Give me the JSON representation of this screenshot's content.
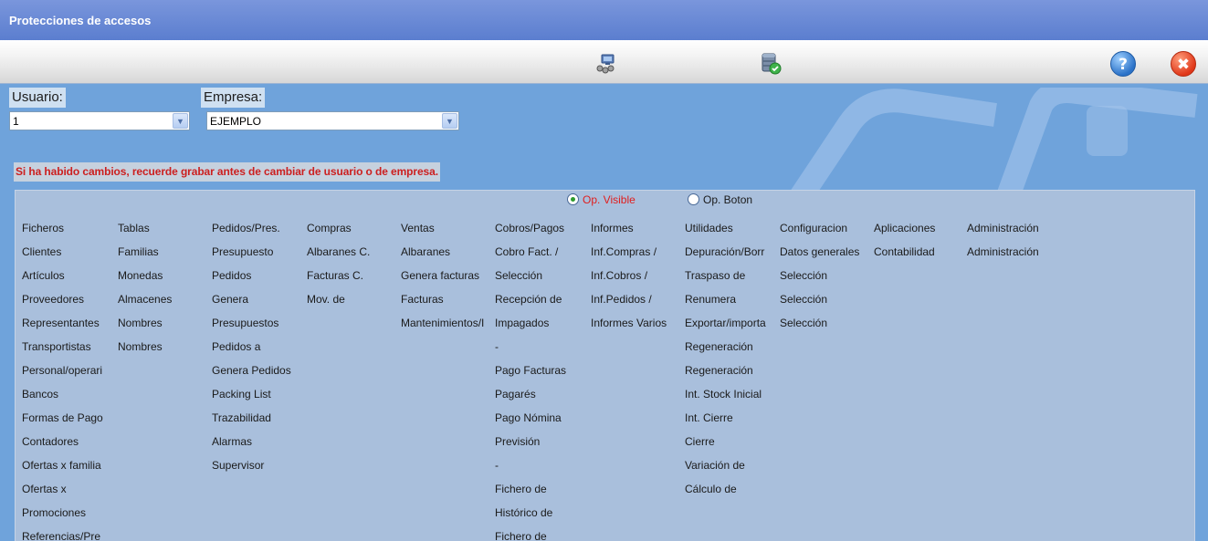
{
  "window": {
    "title": "Protecciones de accesos"
  },
  "toolbar": {
    "icons": [
      "users-network-icon",
      "database-check-icon"
    ],
    "help_glyph": "?",
    "close_glyph": "✖"
  },
  "usuario": {
    "label": "Usuario:",
    "value": "1"
  },
  "empresa": {
    "label": "Empresa:",
    "value": "EJEMPLO"
  },
  "warning": "Si ha habido cambios, recuerde grabar antes de cambiar de usuario o de empresa.",
  "options": {
    "visible": {
      "label": "Op. Visible",
      "selected": true
    },
    "boton": {
      "label": "Op. Boton",
      "selected": false
    }
  },
  "colors": {
    "warning": "#cc1f1f",
    "selected_option": "#e01e1e",
    "panel": "#a9bfdc"
  },
  "menu_columns": [
    {
      "items": [
        "Ficheros",
        "Clientes",
        "Artículos",
        "Proveedores",
        "Representantes",
        "Transportistas",
        "Personal/operari",
        "Bancos",
        "Formas de Pago",
        "Contadores",
        "Ofertas x familia",
        "Ofertas x",
        "Promociones",
        "Referencias/Pre"
      ]
    },
    {
      "items": [
        "Tablas",
        "Familias",
        "Monedas",
        "Almacenes",
        "Nombres",
        "Nombres"
      ]
    },
    {
      "items": [
        "Pedidos/Pres.",
        "Presupuesto",
        "Pedidos",
        "Genera",
        "Presupuestos",
        "Pedidos a",
        "Genera Pedidos",
        "Packing List",
        "Trazabilidad",
        "Alarmas",
        "Supervisor"
      ]
    },
    {
      "items": [
        "Compras",
        "Albaranes C.",
        "Facturas C.",
        "Mov. de"
      ]
    },
    {
      "items": [
        "Ventas",
        "Albaranes",
        "Genera facturas",
        "Facturas",
        "Mantenimientos/I"
      ]
    },
    {
      "items": [
        "Cobros/Pagos",
        "Cobro Fact. /",
        "Selección",
        "Recepción de",
        "Impagados",
        "-",
        "Pago Facturas",
        "Pagarés",
        "Pago Nómina",
        "Previsión",
        "-",
        "Fichero de",
        "Histórico de",
        "Fichero de"
      ]
    },
    {
      "items": [
        "Informes",
        "Inf.Compras /",
        "Inf.Cobros /",
        "Inf.Pedidos /",
        "Informes Varios"
      ]
    },
    {
      "items": [
        "Utilidades",
        "Depuración/Borr",
        "Traspaso de",
        "Renumera",
        "Exportar/importa",
        "Regeneración",
        "Regeneración",
        "Int. Stock Inicial",
        "Int. Cierre",
        "Cierre",
        "Variación de",
        "Cálculo de"
      ]
    },
    {
      "items": [
        "Configuracion",
        "Datos generales",
        "Selección",
        "Selección",
        "Selección"
      ]
    },
    {
      "items": [
        "Aplicaciones",
        "Contabilidad"
      ]
    },
    {
      "items": [
        "Administración",
        "Administración"
      ]
    }
  ]
}
